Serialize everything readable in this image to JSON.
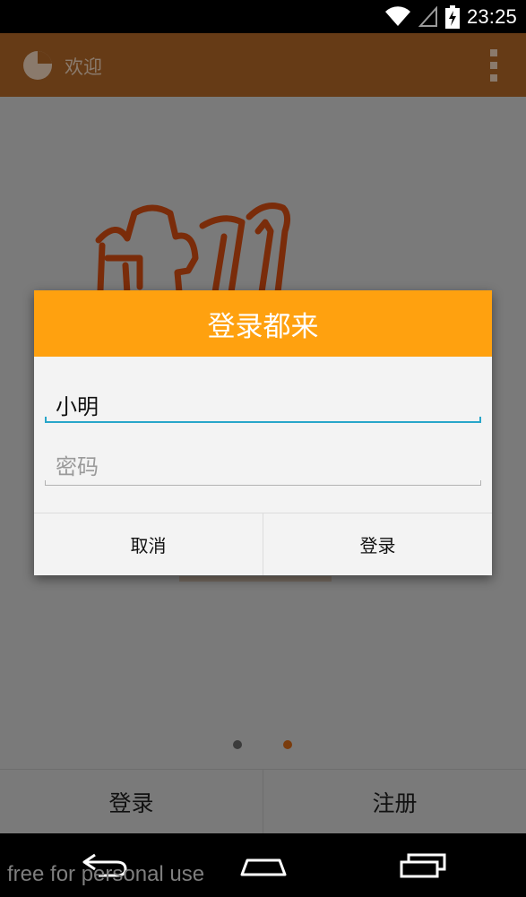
{
  "status_bar": {
    "time": "23:25",
    "icons": [
      "wifi-icon",
      "signal-icon",
      "battery-charging-icon"
    ]
  },
  "action_bar": {
    "logo_icon": "app-logo-icon",
    "title": "欢迎",
    "menu_icon": "overflow-menu-icon"
  },
  "dialog": {
    "title": "登录都来",
    "username_value": "小明",
    "password_placeholder": "密码",
    "cancel_label": "取消",
    "login_label": "登录"
  },
  "pager": {
    "pages": 2,
    "active_index": 1
  },
  "bottom_bar": {
    "login_label": "登录",
    "register_label": "注册"
  },
  "nav_bar": {
    "icons": [
      "back-icon",
      "home-icon",
      "recent-apps-icon"
    ]
  },
  "watermark": "free for personal use",
  "colors": {
    "status_bar": "#000000",
    "action_bar": "#663b16",
    "dim_background": "#7a7a7a",
    "dialog_header": "#ffa10f",
    "dialog_body": "#f3f3f3",
    "input_focus": "#28a6c9",
    "art_stroke": "#7a2c0a"
  }
}
